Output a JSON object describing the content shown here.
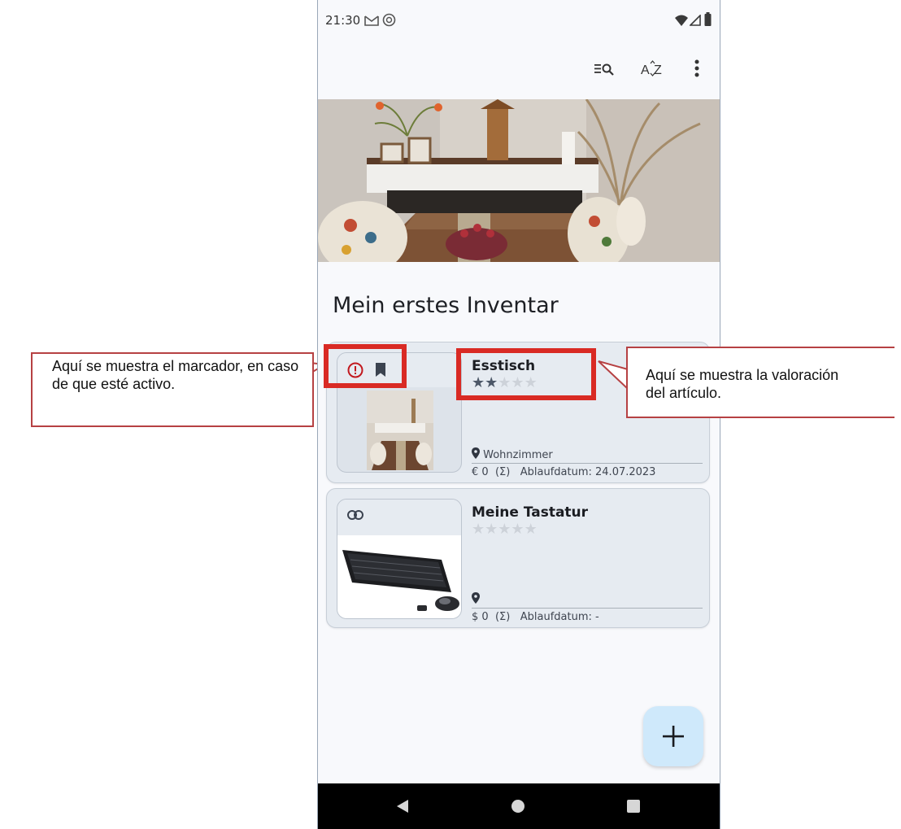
{
  "status_bar": {
    "time": "21:30"
  },
  "page": {
    "title": "Mein erstes Inventar"
  },
  "items": [
    {
      "name": "Esstisch",
      "rating": 2,
      "rating_max": 5,
      "location": "Wohnzimmer",
      "currency": "€",
      "price": "0",
      "sum_label": "(Σ)",
      "expiry_label": "Ablaufdatum:",
      "expiry_value": "24.07.2023",
      "flags": [
        "warning-icon",
        "bookmark-icon"
      ]
    },
    {
      "name": "Meine Tastatur",
      "rating": 0,
      "rating_max": 5,
      "location": "",
      "currency": "$",
      "price": "0",
      "sum_label": "(Σ)",
      "expiry_label": "Ablaufdatum:",
      "expiry_value": "-",
      "flags": [
        "link-icon"
      ]
    }
  ],
  "callouts": {
    "bookmark": "Aquí se muestra el marcador, en caso de que esté activo.",
    "rating": "Aquí se muestra la valoración del artículo."
  },
  "colors": {
    "highlight": "#d92a24",
    "callout_border": "#b64143",
    "card": "#e6ebf1",
    "fab": "#cfe9fb"
  }
}
